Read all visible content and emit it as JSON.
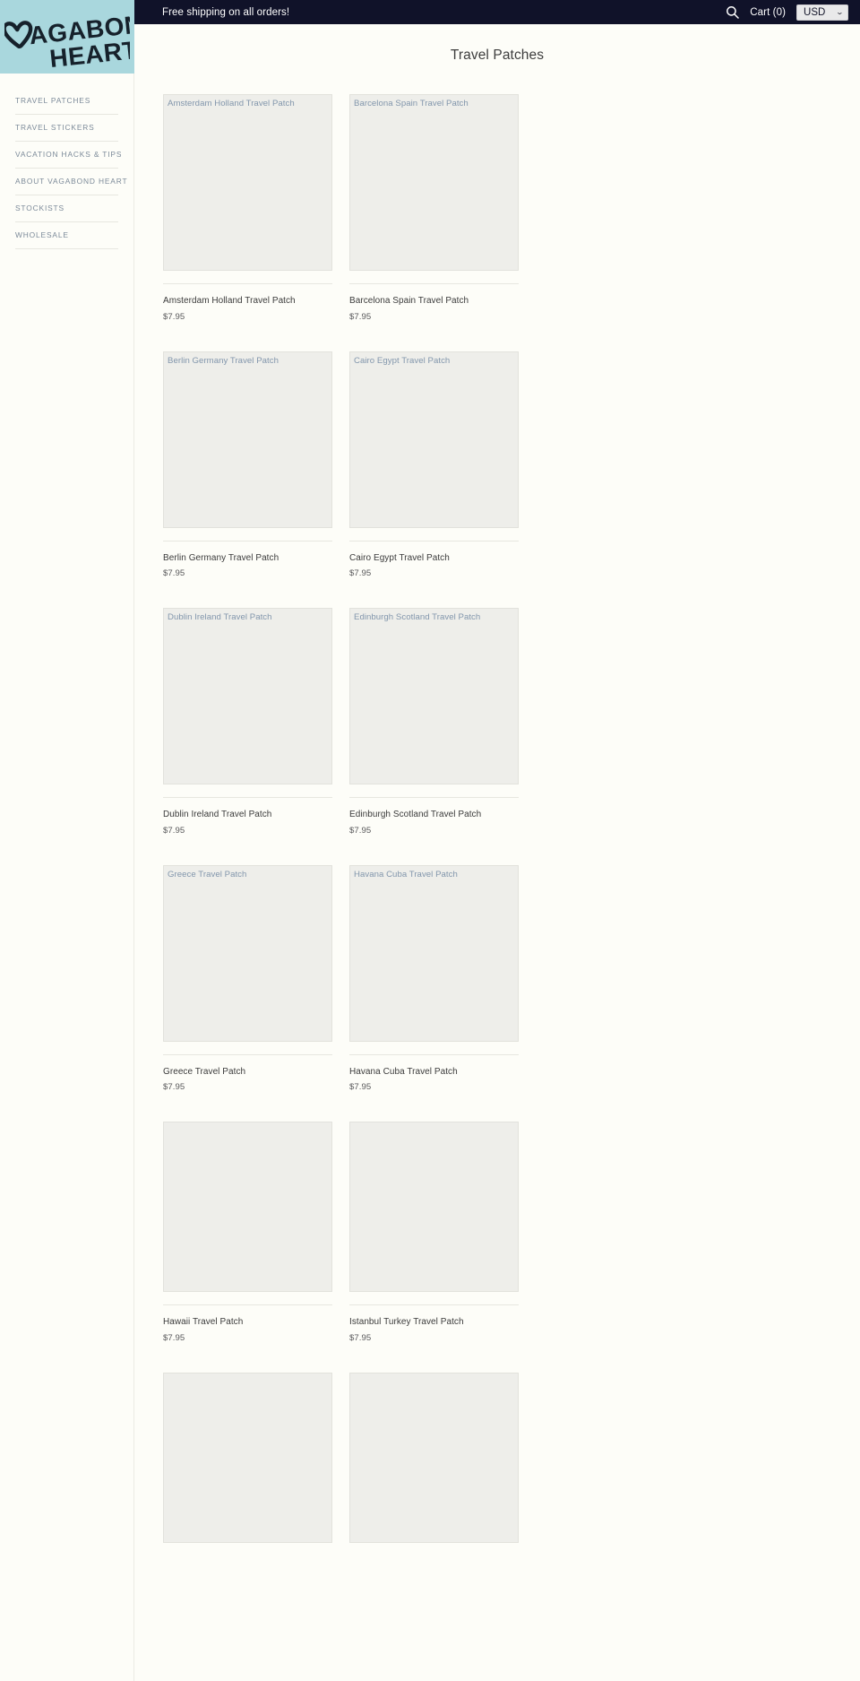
{
  "topbar": {
    "announcement": "Free shipping on all orders!",
    "search_icon": "search-icon",
    "cart_label": "Cart (0)",
    "currency_value": "USD",
    "currency_chevron": "⌄",
    "currency_options": [
      "USD"
    ]
  },
  "brand": {
    "line1": "VAGABOND",
    "line2": "HEART",
    "logo_bg": "#a9d7dd",
    "logo_fg": "#16212b"
  },
  "sidebar": {
    "items": [
      {
        "label": "TRAVEL PATCHES"
      },
      {
        "label": "TRAVEL STICKERS"
      },
      {
        "label": "VACATION HACKS & TIPS"
      },
      {
        "label": "ABOUT VAGABOND HEART"
      },
      {
        "label": "STOCKISTS"
      },
      {
        "label": "WHOLESALE"
      }
    ]
  },
  "main": {
    "page_title": "Travel Patches",
    "products": [
      {
        "title": "Amsterdam Holland Travel Patch",
        "price": "$7.95",
        "alt": "Amsterdam Holland Travel Patch"
      },
      {
        "title": "Barcelona Spain Travel Patch",
        "price": "$7.95",
        "alt": "Barcelona Spain Travel Patch"
      },
      {
        "title": "Berlin Germany Travel Patch",
        "price": "$7.95",
        "alt": "Berlin Germany Travel Patch"
      },
      {
        "title": "Cairo Egypt Travel Patch",
        "price": "$7.95",
        "alt": "Cairo Egypt Travel Patch"
      },
      {
        "title": "Dublin Ireland Travel Patch",
        "price": "$7.95",
        "alt": "Dublin Ireland Travel Patch"
      },
      {
        "title": "Edinburgh Scotland Travel Patch",
        "price": "$7.95",
        "alt": "Edinburgh Scotland Travel Patch"
      },
      {
        "title": "Greece Travel Patch",
        "price": "$7.95",
        "alt": "Greece Travel Patch"
      },
      {
        "title": "Havana Cuba Travel Patch",
        "price": "$7.95",
        "alt": "Havana Cuba Travel Patch"
      },
      {
        "title": "Hawaii Travel Patch",
        "price": "$7.95",
        "alt": ""
      },
      {
        "title": "Istanbul Turkey Travel Patch",
        "price": "$7.95",
        "alt": ""
      },
      {
        "title": "",
        "price": "",
        "alt": ""
      },
      {
        "title": "",
        "price": "",
        "alt": ""
      }
    ]
  },
  "colors": {
    "topbar_bg": "#101229",
    "page_bg": "#fdfdf8",
    "accent_teal": "#a9d7dd",
    "nav_text": "#7c8a99",
    "thumb_bg": "#eeeeea",
    "alt_text": "#8296ac"
  }
}
